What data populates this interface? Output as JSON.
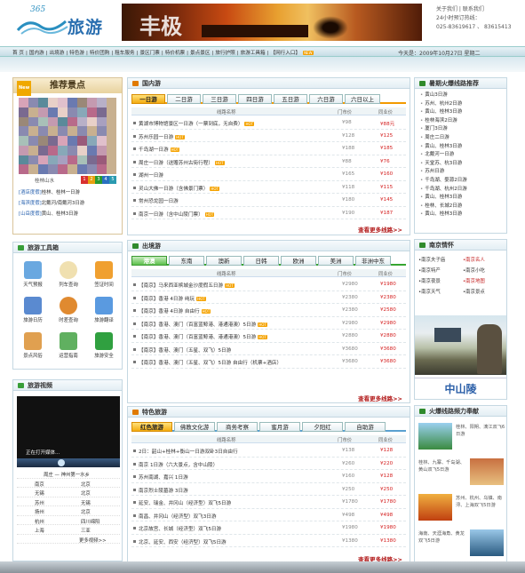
{
  "header": {
    "logo_number": "365",
    "logo_text": "旅游",
    "banner_text": "丰极",
    "contact": [
      "关于我们  |  联系我们",
      "24小时预订热线：",
      "025-83619617 、 83615413"
    ]
  },
  "nav": {
    "items": [
      "首 页",
      "国内游",
      "出境游",
      "特色游",
      "特价团购",
      "租车服务",
      "景区门票",
      "特价机票",
      "景点景区",
      "旅行护照",
      "旅游工具箱",
      "【网行入口】"
    ],
    "new_tag": "NEW",
    "date": "今天是：2009年10月27日 星期二"
  },
  "recommend": {
    "new_badge": "New",
    "title": "推荐景点",
    "caption": "桂林山水",
    "pager": [
      "1",
      "2",
      "3",
      "4",
      "5"
    ],
    "links": [
      {
        "tag": "[酒店度假]",
        "text": "桂林、桂林一日游"
      },
      {
        "tag": "[海滨度假]",
        "text": "北戴河/南戴河3日游"
      },
      {
        "tag": "[山岳度假]",
        "text": "黄山、桂林3日游"
      }
    ]
  },
  "tools": {
    "title": "旅游工具箱",
    "items": [
      "天气预报",
      "列车查询",
      "签证时间",
      "旅游日历",
      "时差查询",
      "旅游翻译",
      "景点风俗",
      "运营指南",
      "旅游安全"
    ]
  },
  "video": {
    "title": "旅游视频",
    "playing": "正在打开媒体...",
    "list_header": "周庄 — 神州第一水乡",
    "list": [
      [
        "南京",
        "北京"
      ],
      [
        "无锡",
        "北京"
      ],
      [
        "苏州",
        "无锡"
      ],
      [
        "扬州",
        "北京"
      ],
      [
        "杭州",
        "四川绵阳"
      ],
      [
        "上海",
        "三亚"
      ]
    ],
    "more": "更多视频>>"
  },
  "domestic": {
    "title": "国内游",
    "tabs": [
      "一日游",
      "二日游",
      "三日游",
      "四日游",
      "五日游",
      "六日游",
      "六日以上"
    ],
    "cols": [
      "线路名称",
      "门市价",
      "同业价"
    ],
    "rows": [
      {
        "name": "黄湖市博物馆景区一日游（一票到底，无自费）",
        "p1": "¥98",
        "p2": "¥88元",
        "hot": true
      },
      {
        "name": "苏州乐园一日游",
        "p1": "¥128",
        "p2": "¥125",
        "hot": true
      },
      {
        "name": "千岛湖一日游",
        "p1": "¥188",
        "p2": "¥185",
        "hot": true
      },
      {
        "name": "周庄一日游（送赠苏州古街行程）",
        "p1": "¥88",
        "p2": "¥76",
        "hot": true
      },
      {
        "name": "湖州一日游",
        "p1": "¥165",
        "p2": "¥160",
        "hot": false
      },
      {
        "name": "灵山大佛一日游（含佛景门票）",
        "p1": "¥118",
        "p2": "¥115",
        "hot": true
      },
      {
        "name": "常州恐龙园一日游",
        "p1": "¥180",
        "p2": "¥145",
        "hot": false
      },
      {
        "name": "南京一日游（含中山陵门票）",
        "p1": "¥190",
        "p2": "¥187",
        "hot": true
      }
    ],
    "more": "查看更多线路>>"
  },
  "outbound": {
    "title": "出境游",
    "tabs": [
      "港澳",
      "东南",
      "澳新",
      "日韩",
      "欧洲",
      "美洲",
      "非洲中东"
    ],
    "cols": [
      "线路名称",
      "门市价",
      "同业价"
    ],
    "rows": [
      {
        "name": "【南京】马来西亚槟城金沙度假五日游",
        "p1": "¥2980",
        "p2": "¥1980",
        "hot": true
      },
      {
        "name": "【南京】香港 4日游  纯玩",
        "p1": "¥2380",
        "p2": "¥2380",
        "hot": true
      },
      {
        "name": "【南京】香港 4日游  自由行",
        "p1": "¥2380",
        "p2": "¥2580",
        "hot": true
      },
      {
        "name": "【南京】香港、澳门（百富蓝鲸港、港通港澳）5日游",
        "p1": "¥2980",
        "p2": "¥2980",
        "hot": true
      },
      {
        "name": "【南京】香港、澳门（百富蓝鲸港、港通港澳）5日游",
        "p1": "¥2880",
        "p2": "¥2880",
        "hot": true
      },
      {
        "name": "【南京】香港、澳门（五星、双飞）5日游",
        "p1": "¥3680",
        "p2": "¥3680",
        "hot": false
      },
      {
        "name": "【南京】香港、澳门（五星、双飞）5日游 自由行（机票+酒店）",
        "p1": "¥3680",
        "p2": "¥3680",
        "hot": false
      }
    ],
    "more": "查看更多线路>>"
  },
  "special": {
    "title": "特色旅游",
    "tabs": [
      "红色旅游",
      "佛教文化游",
      "商务考察",
      "蜜月游",
      "夕阳红",
      "自助游"
    ],
    "cols": [
      "线路名称",
      "门市价",
      "同业价"
    ],
    "rows": [
      {
        "name": "2日：韶山+桂林+衡山一日游双卧3日自由行",
        "p1": "¥138",
        "p2": "¥128"
      },
      {
        "name": "南京  1日游（六大景点，含中山陵）",
        "p1": "¥260",
        "p2": "¥220"
      },
      {
        "name": "苏州南湖、嘉兴 1日游",
        "p1": "¥160",
        "p2": "¥128"
      },
      {
        "name": "南京烈士陵墓游  3日游",
        "p1": "¥250",
        "p2": "¥250"
      },
      {
        "name": "延安、瑞金、井冈山（经济型）双飞5日游",
        "p1": "¥1780",
        "p2": "¥1780"
      },
      {
        "name": "南昌、井冈山（经济型）双飞3日游",
        "p1": "¥498",
        "p2": "¥498"
      },
      {
        "name": "北京故宫、长城（经济型）双飞5日游",
        "p1": "¥1980",
        "p2": "¥1980"
      },
      {
        "name": "北京、延安、西安（经济型）双飞5日游",
        "p1": "¥1380",
        "p2": "¥1380"
      }
    ],
    "more": "查看更多线路>>"
  },
  "hotlines": {
    "title": "暑期火爆线路推荐",
    "items": [
      "黄山3日游",
      "苏州、杭州2日游",
      "黄山、桂林3日游",
      "桂林海滨2日游",
      "厦门3日游",
      "周庄二日游",
      "黄山、桂林3日游",
      "北戴河一日游",
      "天堂苏、杭3日游",
      "苏州日游",
      "千岛湖、婺源2日游",
      "千岛湖、杭州2日游",
      "黄山、桂林3日游",
      "桂林、长城2日游",
      "黄山、桂林3日游"
    ]
  },
  "nanjing": {
    "title": "南京情怀",
    "items": [
      {
        "text": "南京夫子庙",
        "red": false
      },
      {
        "text": "南京名人",
        "red": true
      },
      {
        "text": "南京特产",
        "red": false
      },
      {
        "text": "南京小吃",
        "red": false
      },
      {
        "text": "南京夜景",
        "red": false
      },
      {
        "text": "南京地图",
        "red": true
      },
      {
        "text": "南京天气",
        "red": false
      },
      {
        "text": "南京景点",
        "red": false
      }
    ],
    "caption": "中山陵"
  },
  "frequency": {
    "title": "火爆线路频力奉献",
    "items": [
      "桂林、阳朔、漓江双飞6日游",
      "桂林、九寨、千岛湖、黄山双飞5日游",
      "苏州、杭州、乌镇、南浔、上海双飞5日游",
      "海南、天涯海角、黄龙双飞5日游"
    ]
  },
  "colors": {
    "accent_orange": "#f4ac10",
    "accent_green": "#36a530",
    "price_red": "#d42020",
    "link_blue": "#2b64b0"
  }
}
